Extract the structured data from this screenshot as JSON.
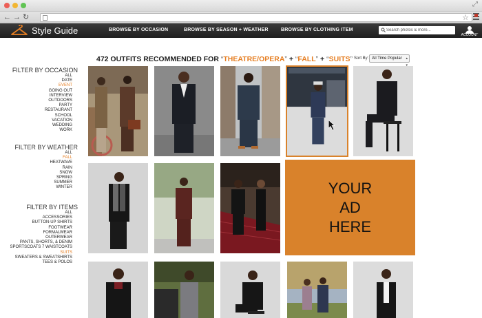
{
  "browser": {
    "url": "",
    "back_icon": "back-arrow-icon",
    "forward_icon": "forward-arrow-icon",
    "reload_icon": "reload-icon"
  },
  "site": {
    "logo_text": "Style Guide",
    "nav": [
      "BROWSE BY OCCASION",
      "BROWSE BY SEASON + WEATHER",
      "BROWSE BY CLOTHING ITEM"
    ],
    "search_placeholder": "Search photos & more...",
    "account_label": "ACCOUNT"
  },
  "heading": {
    "prefix": "472 OUTFITS RECOMMENDED FOR ",
    "open_quote": "“",
    "close_quote": "”",
    "plus": " + ",
    "terms": [
      "THEATRE/OPERA",
      "FALL",
      "SUITS"
    ]
  },
  "sort": {
    "label": "Sort By:",
    "selected": "All Time Popular"
  },
  "filters": {
    "occasion": {
      "title": "FILTER BY OCCASION",
      "items": [
        "ALL",
        "DATE",
        "EVENT",
        "GOING OUT",
        "INTERVIEW",
        "OUTDOORS",
        "PARTY",
        "RESTAURANT",
        "SCHOOL",
        "VACATION",
        "WEDDING",
        "WORK"
      ],
      "active": "EVENT"
    },
    "weather": {
      "title": "FILTER BY WEATHER",
      "items": [
        "ALL",
        "FALL",
        "HEATWAVE",
        "RAIN",
        "SNOW",
        "SPRING",
        "SUMMER",
        "WINTER"
      ],
      "active": "FALL"
    },
    "items": {
      "title": "FILTER BY ITEMS",
      "items": [
        "ALL",
        "ACCESSORIES",
        "BUTTON-UP SHIRTS",
        "FOOTWEAR",
        "FORMALWEAR",
        "OUTERWEAR",
        "PANTS, SHORTS, & DENIM",
        "SPORTSCOATS 7 WAISTCOATS",
        "SUITS",
        "SWEATERS & SWEATSHIRTS",
        "TEES & POLOS"
      ],
      "active": "SUITS"
    }
  },
  "ad": {
    "text": "YOUR\nAD\nHERE"
  },
  "colors": {
    "accent": "#e67e22",
    "ad_background": "#d9822b",
    "nav_background": "#2a2a2a"
  }
}
